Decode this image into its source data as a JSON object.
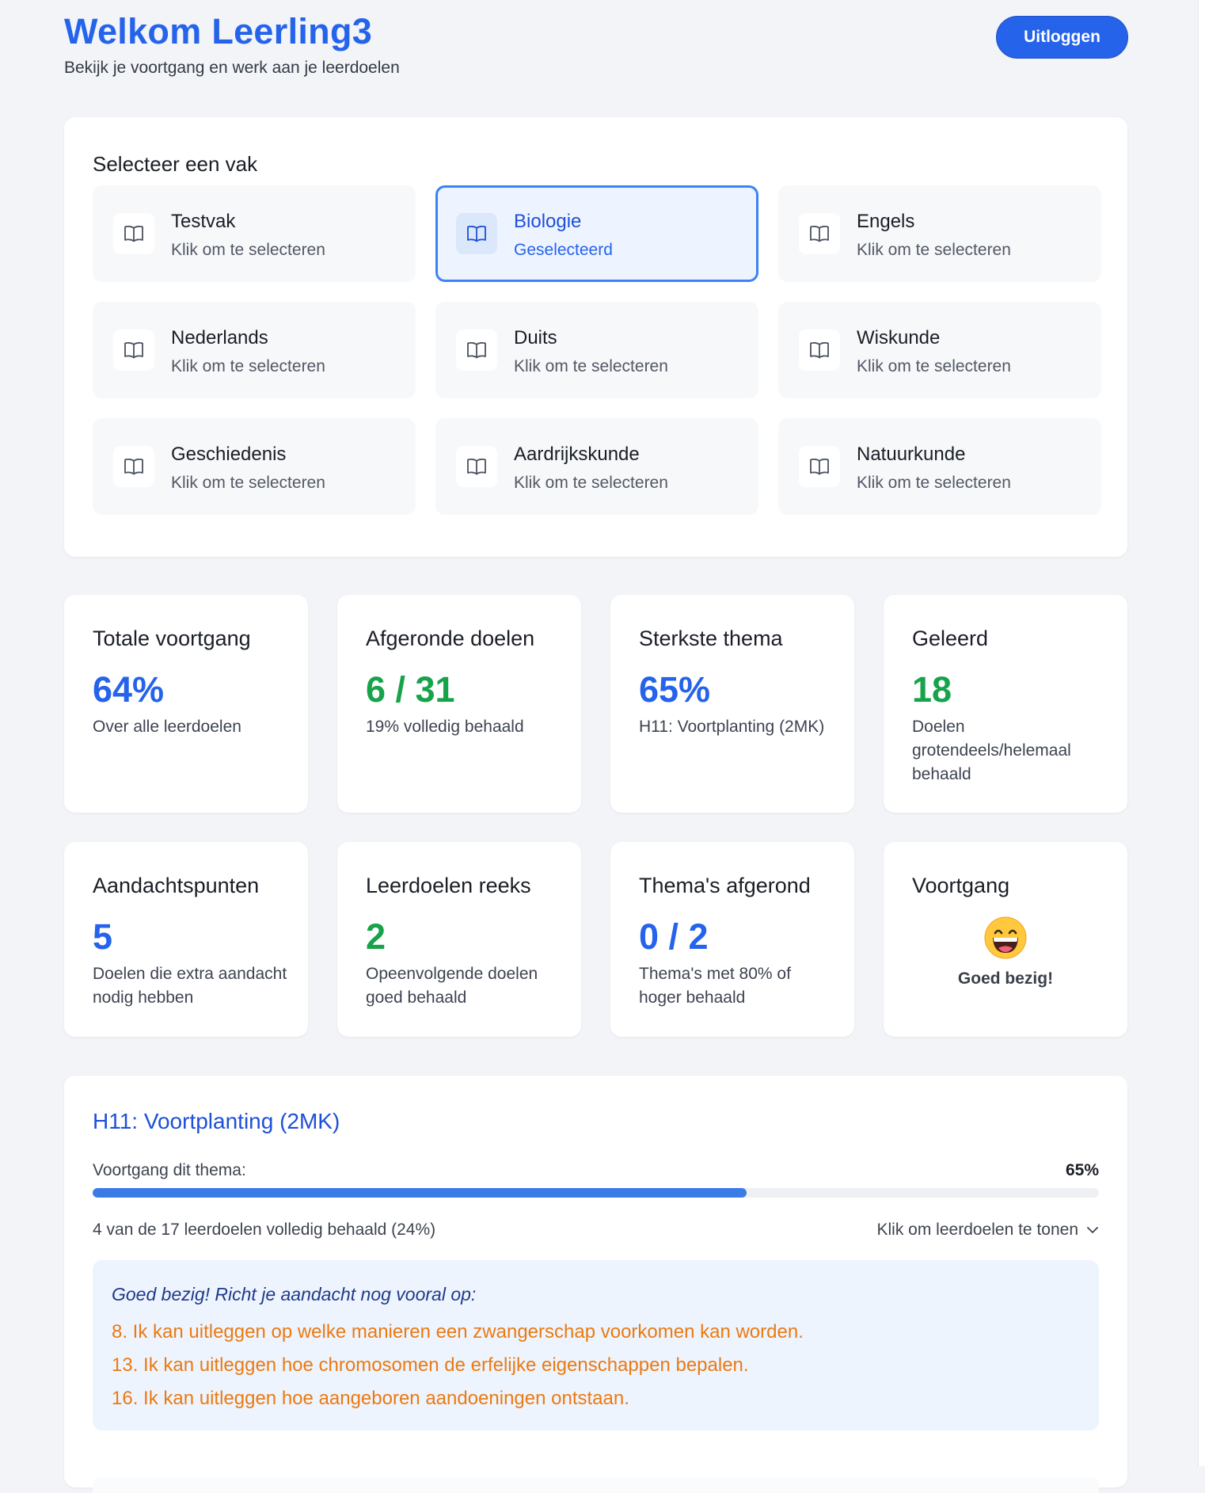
{
  "header": {
    "title": "Welkom Leerling3",
    "subtitle": "Bekijk je voortgang en werk aan je leerdoelen",
    "logout_label": "Uitloggen"
  },
  "subjects": {
    "heading": "Selecteer een vak",
    "items": [
      {
        "name": "Testvak",
        "hint": "Klik om te selecteren"
      },
      {
        "name": "Biologie",
        "hint": "Geselecteerd"
      },
      {
        "name": "Engels",
        "hint": "Klik om te selecteren"
      },
      {
        "name": "Nederlands",
        "hint": "Klik om te selecteren"
      },
      {
        "name": "Duits",
        "hint": "Klik om te selecteren"
      },
      {
        "name": "Wiskunde",
        "hint": "Klik om te selecteren"
      },
      {
        "name": "Geschiedenis",
        "hint": "Klik om te selecteren"
      },
      {
        "name": "Aardrijkskunde",
        "hint": "Klik om te selecteren"
      },
      {
        "name": "Natuurkunde",
        "hint": "Klik om te selecteren"
      }
    ],
    "selected_icon": "book-icon"
  },
  "stats": [
    {
      "label": "Totale voortgang",
      "value": "64%",
      "desc": "Over alle leerdoelen"
    },
    {
      "label": "Afgeronde doelen",
      "value": "6 / 31",
      "desc": "19% volledig behaald"
    },
    {
      "label": "Sterkste thema",
      "value": "65%",
      "desc": "H11: Voortplanting (2MK)"
    },
    {
      "label": "Geleerd",
      "value": "18",
      "desc": "Doelen grotendeels/helemaal behaald"
    },
    {
      "label": "Aandachtspunten",
      "value": "5",
      "desc": "Doelen die extra aandacht nodig hebben"
    },
    {
      "label": "Leerdoelen reeks",
      "value": "2",
      "desc": "Opeenvolgende doelen goed behaald"
    },
    {
      "label": "Thema's afgerond",
      "value": "0 / 2",
      "desc": "Thema's met 80% of hoger behaald"
    },
    {
      "label": "Voortgang",
      "status": "Goed bezig!",
      "icon": "grinning-face-icon"
    }
  ],
  "colors": {
    "accent": "#2563eb",
    "green": "#16a34a",
    "orange": "#ea7a12"
  },
  "theme": {
    "title": "H11: Voortplanting (2MK)",
    "progress_label": "Voortgang dit thema:",
    "progress_pct": "65%",
    "progress_fraction": 0.65,
    "completed_text": "4 van de 17 leerdoelen volledig behaald (24%)",
    "toggle_label": "Klik om leerdoelen te tonen",
    "focus_intro": "Goed bezig! Richt je aandacht nog vooral op:",
    "focus_items": [
      "8. Ik kan uitleggen op welke manieren een zwangerschap voorkomen kan worden.",
      "13. Ik kan uitleggen hoe chromosomen de erfelijke eigenschappen bepalen.",
      "16. Ik kan uitleggen hoe aangeboren aandoeningen ontstaan."
    ]
  }
}
